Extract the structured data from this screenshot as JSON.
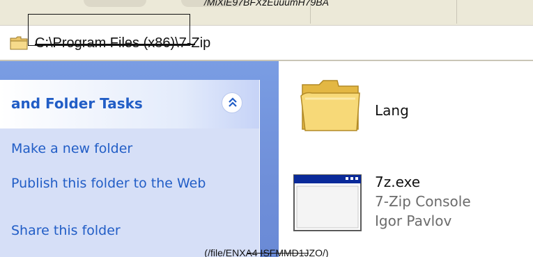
{
  "window": {
    "top_caption": "/MiXiE97BFXzEuuumH79BA"
  },
  "address_bar": {
    "path": "C:\\Program Files (x86)\\7-Zip",
    "icon": "folder-icon"
  },
  "task_panel": {
    "title": "and Folder Tasks",
    "collapse_icon": "chevron-double-up-icon",
    "items": [
      {
        "label": "Make a new folder"
      },
      {
        "label": "Publish this folder to the Web"
      },
      {
        "label": "Share this folder"
      }
    ]
  },
  "files": [
    {
      "name": "Lang",
      "icon": "folder-icon"
    },
    {
      "name": "7z.exe",
      "description": "7-Zip Console",
      "company": "Igor Pavlov",
      "icon": "application-window-icon"
    }
  ],
  "bottom_caption": "(/file/ENXA4 ISFMMD1JZO/)",
  "colors": {
    "task_link": "#215dc6",
    "pane_blue": "#6f8fd9",
    "panel_bg": "#d6dff7"
  }
}
